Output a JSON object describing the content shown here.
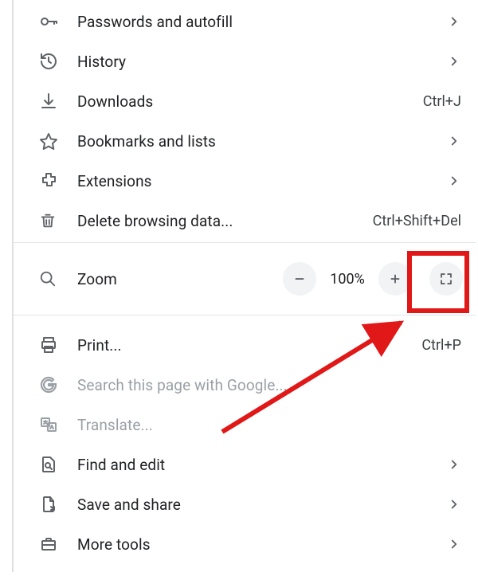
{
  "items": {
    "passwords": {
      "label": "Passwords and autofill"
    },
    "history": {
      "label": "History"
    },
    "downloads": {
      "label": "Downloads",
      "shortcut": "Ctrl+J"
    },
    "bookmarks": {
      "label": "Bookmarks and lists"
    },
    "extensions": {
      "label": "Extensions"
    },
    "deleteBrowsing": {
      "label": "Delete browsing data...",
      "shortcut": "Ctrl+Shift+Del"
    },
    "zoom": {
      "label": "Zoom",
      "value": "100%"
    },
    "print": {
      "label": "Print...",
      "shortcut": "Ctrl+P"
    },
    "searchGoogle": {
      "label": "Search this page with Google..."
    },
    "translate": {
      "label": "Translate..."
    },
    "findEdit": {
      "label": "Find and edit"
    },
    "saveShare": {
      "label": "Save and share"
    },
    "moreTools": {
      "label": "More tools"
    }
  },
  "annotation": {
    "highlightTarget": "fullscreen-button"
  }
}
